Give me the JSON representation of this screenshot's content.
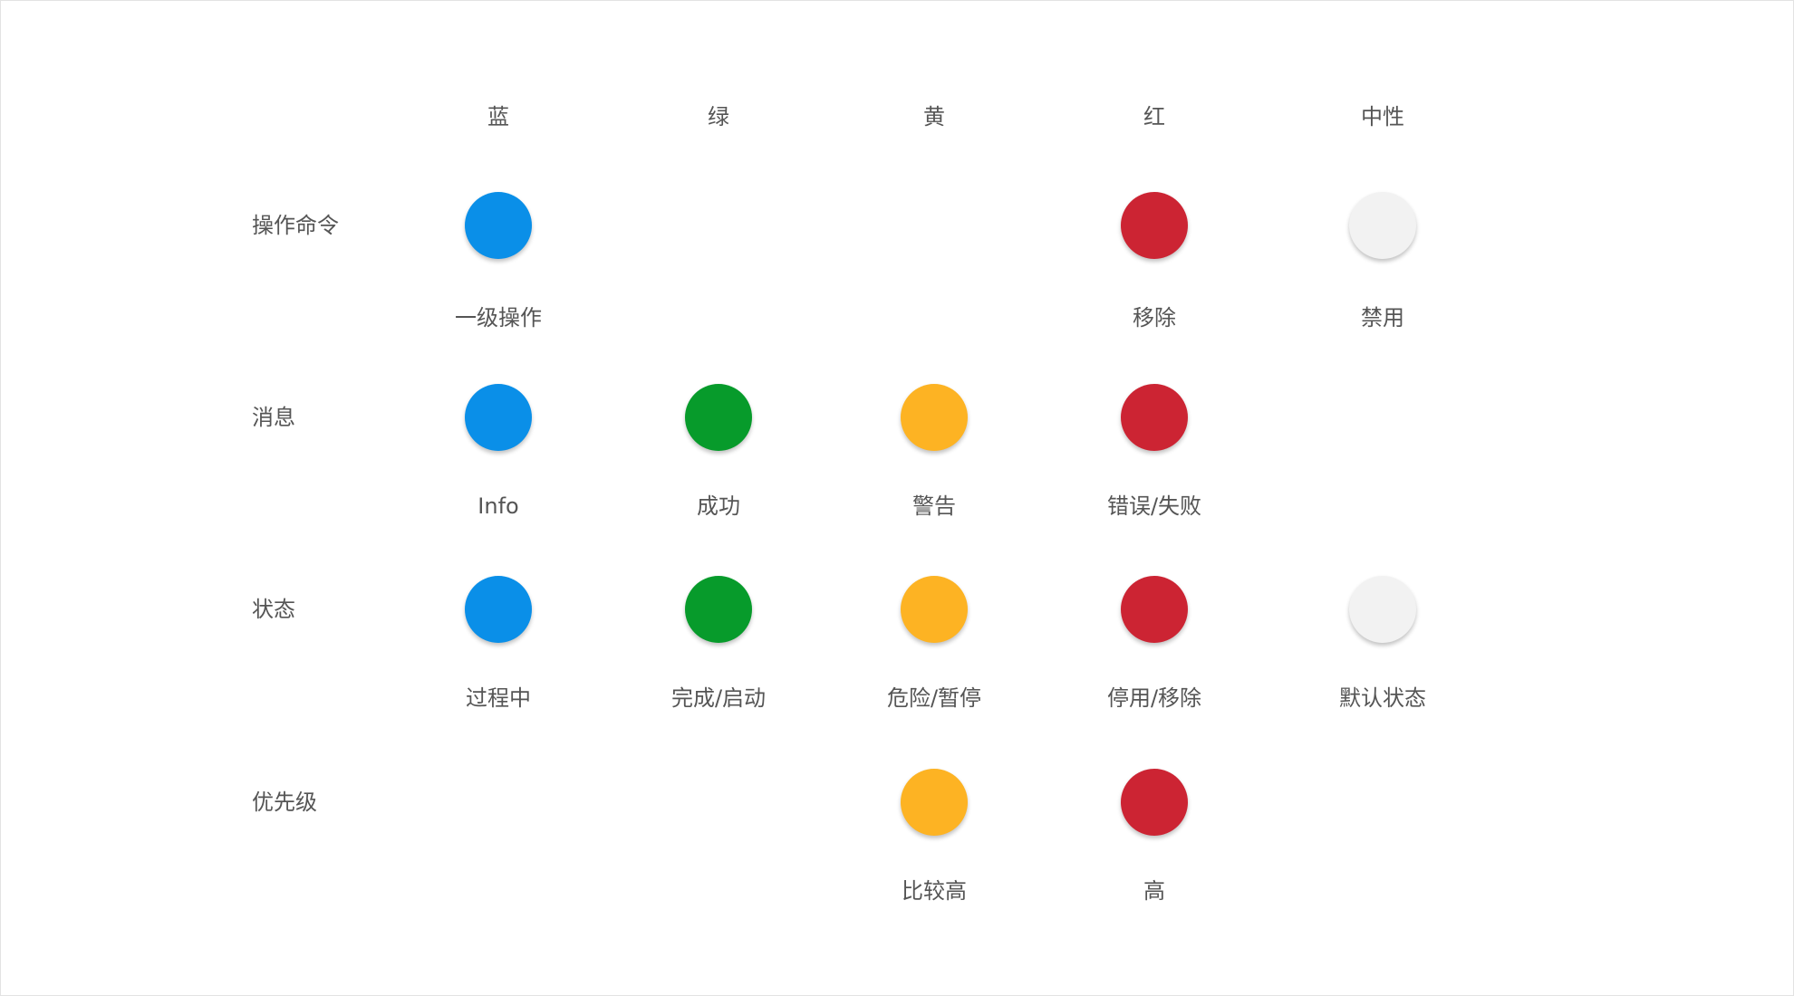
{
  "colors": {
    "blue": "#0A8FE8",
    "green": "#079B2B",
    "yellow": "#FDB323",
    "red": "#CC2433",
    "neutral": "#F2F2F2"
  },
  "columns": [
    {
      "key": "blue",
      "label": "蓝"
    },
    {
      "key": "green",
      "label": "绿"
    },
    {
      "key": "yellow",
      "label": "黄"
    },
    {
      "key": "red",
      "label": "红"
    },
    {
      "key": "neutral",
      "label": "中性"
    }
  ],
  "rows": [
    {
      "label": "操作命令",
      "cells": [
        {
          "col": "blue",
          "label": "一级操作"
        },
        {
          "col": "red",
          "label": "移除"
        },
        {
          "col": "neutral",
          "label": "禁用"
        }
      ]
    },
    {
      "label": "消息",
      "cells": [
        {
          "col": "blue",
          "label": "Info"
        },
        {
          "col": "green",
          "label": "成功"
        },
        {
          "col": "yellow",
          "label": "警告"
        },
        {
          "col": "red",
          "label": "错误/失败"
        }
      ]
    },
    {
      "label": "状态",
      "cells": [
        {
          "col": "blue",
          "label": "过程中"
        },
        {
          "col": "green",
          "label": "完成/启动"
        },
        {
          "col": "yellow",
          "label": "危险/暂停"
        },
        {
          "col": "red",
          "label": "停用/移除"
        },
        {
          "col": "neutral",
          "label": "默认状态"
        }
      ]
    },
    {
      "label": "优先级",
      "cells": [
        {
          "col": "yellow",
          "label": "比较高"
        },
        {
          "col": "red",
          "label": "高"
        }
      ]
    }
  ]
}
